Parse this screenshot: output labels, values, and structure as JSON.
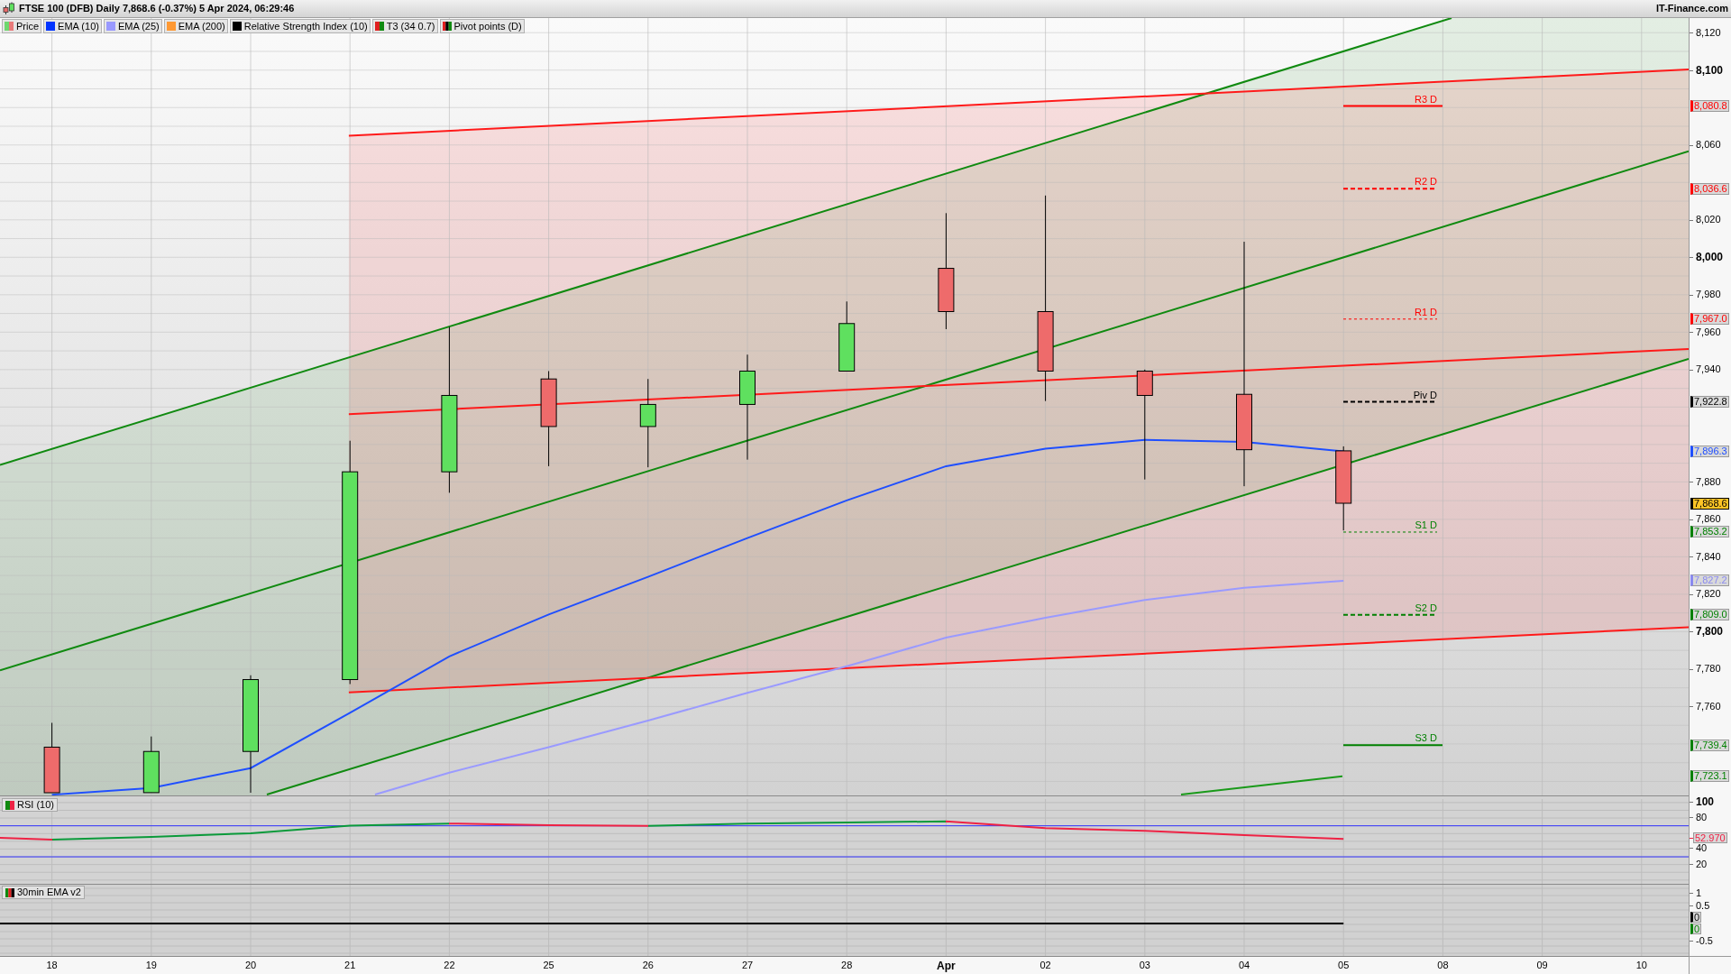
{
  "title_bar": {
    "title": "FTSE 100 (DFB) Daily 7,868.6 (-0.37%) 5 Apr 2024, 06:29:46",
    "brand": "IT-Finance.com"
  },
  "legend": [
    {
      "label": "Price",
      "kind": "candle"
    },
    {
      "label": "EMA (10)",
      "kind": "swatch",
      "color": "#0033ff"
    },
    {
      "label": "EMA (25)",
      "kind": "swatch",
      "color": "#9999ff"
    },
    {
      "label": "EMA (200)",
      "kind": "swatch",
      "color": "#ff9933"
    },
    {
      "label": "Relative Strength Index (10)",
      "kind": "swatch",
      "color": "#000000"
    },
    {
      "label": "T3 (34 0.7)",
      "kind": "dual"
    },
    {
      "label": "Pivot points (D)",
      "kind": "triple"
    }
  ],
  "price_panel": {
    "pivot_lines": [
      {
        "label": "R3 D",
        "color": "#ff0000",
        "kind": "solid"
      },
      {
        "label": "R2 D",
        "color": "#ff0000",
        "kind": "dashed"
      },
      {
        "label": "R1 D",
        "color": "#ff0000",
        "kind": "fine"
      },
      {
        "label": "Piv D",
        "color": "#000000",
        "kind": "dashed"
      },
      {
        "label": "S1 D",
        "color": "#008000",
        "kind": "fine"
      },
      {
        "label": "S2 D",
        "color": "#008000",
        "kind": "dashed"
      },
      {
        "label": "S3 D",
        "color": "#008000",
        "kind": "solid"
      }
    ],
    "axis_labels": [
      {
        "text": "8,120",
        "major": false
      },
      {
        "text": "8,100",
        "major": true
      },
      {
        "text": "8,060",
        "major": false
      },
      {
        "text": "8,020",
        "major": false
      },
      {
        "text": "8,000",
        "major": true
      },
      {
        "text": "7,980",
        "major": false
      },
      {
        "text": "7,960",
        "major": false
      },
      {
        "text": "7,940",
        "major": false
      },
      {
        "text": "7,880",
        "major": false
      },
      {
        "text": "7,860",
        "major": false
      },
      {
        "text": "7,840",
        "major": false
      },
      {
        "text": "7,820",
        "major": false
      },
      {
        "text": "7,800",
        "major": true
      },
      {
        "text": "7,780",
        "major": false
      },
      {
        "text": "7,760",
        "major": false
      }
    ],
    "price_tags": [
      {
        "text": "8,080.8",
        "color": "#ff0000",
        "highlighted": false
      },
      {
        "text": "8,036.6",
        "color": "#ff0000",
        "highlighted": false
      },
      {
        "text": "7,967.0",
        "color": "#ff0000",
        "highlighted": false
      },
      {
        "text": "7,922.8",
        "color": "#000000",
        "highlighted": false
      },
      {
        "text": "7,896.3",
        "color": "#1f4fff",
        "highlighted": false
      },
      {
        "text": "7,868.6",
        "color": "#000000",
        "highlighted": true
      },
      {
        "text": "7,853.2",
        "color": "#008000",
        "highlighted": false
      },
      {
        "text": "7,827.2",
        "color": "#8a8af0",
        "highlighted": false
      },
      {
        "text": "7,809.0",
        "color": "#008000",
        "highlighted": false
      },
      {
        "text": "7,739.4",
        "color": "#008000",
        "highlighted": false
      },
      {
        "text": "7,723.1",
        "color": "#008000",
        "highlighted": false
      }
    ]
  },
  "rsi_panel": {
    "label": "RSI (10)",
    "axis_labels": [
      {
        "text": "100",
        "major": true
      },
      {
        "text": "80",
        "major": false
      },
      {
        "text": "40",
        "major": false
      },
      {
        "text": "20",
        "major": false
      }
    ],
    "value_tag": "52.970"
  },
  "ema30_panel": {
    "label": "30min EMA v2",
    "axis_labels": [
      "1",
      "0.5",
      "-0.5"
    ],
    "value_tags": [
      {
        "text": "0",
        "color": "#000000"
      },
      {
        "text": "0",
        "color": "#008000"
      }
    ]
  },
  "x_axis": [
    {
      "text": "18",
      "major": false
    },
    {
      "text": "19",
      "major": false
    },
    {
      "text": "20",
      "major": false
    },
    {
      "text": "21",
      "major": false
    },
    {
      "text": "22",
      "major": false
    },
    {
      "text": "25",
      "major": false
    },
    {
      "text": "26",
      "major": false
    },
    {
      "text": "27",
      "major": false
    },
    {
      "text": "28",
      "major": false
    },
    {
      "text": "Apr",
      "major": true
    },
    {
      "text": "02",
      "major": false
    },
    {
      "text": "03",
      "major": false
    },
    {
      "text": "04",
      "major": false
    },
    {
      "text": "05",
      "major": false
    },
    {
      "text": "08",
      "major": false
    },
    {
      "text": "09",
      "major": false
    },
    {
      "text": "10",
      "major": false
    }
  ]
}
